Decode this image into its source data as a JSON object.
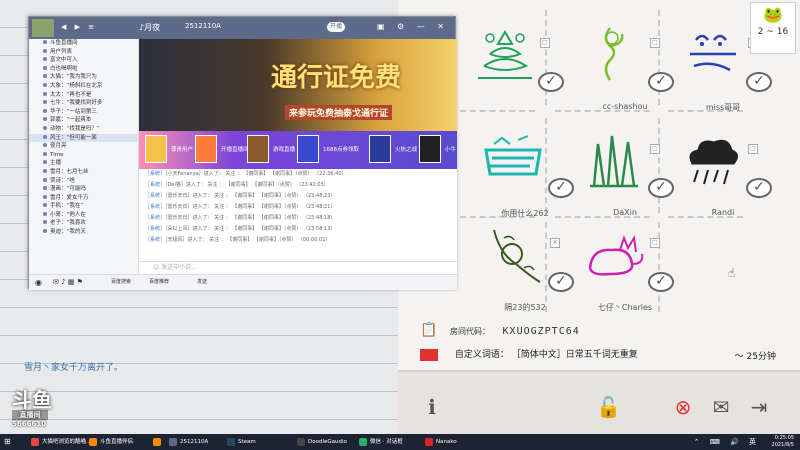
{
  "colors": {
    "accent": "#5d6a8a",
    "gold": "#ffe27a",
    "chat_link": "#3a78c8",
    "taskbar": "#1c2433"
  },
  "background": {
    "chat_message": "雪月丶家女千万离开了。",
    "logo": {
      "text": "斗鱼",
      "sub": "直播间",
      "room": "5666610"
    }
  },
  "game": {
    "round": "2 ~ 16",
    "round_icon": "frog-icon",
    "players": [
      {
        "name": "",
        "color": "#22a05a"
      },
      {
        "name": "cc-shashou",
        "color": "#7bbd2a"
      },
      {
        "name": "miss哥哥",
        "color": "#2840b0"
      },
      {
        "name": "你用什么262",
        "color": "#19b7b0"
      },
      {
        "name": "DaXin",
        "color": "#2a8a4a"
      },
      {
        "name": "Randi",
        "color": "#333333"
      },
      {
        "name": "隔23的532",
        "color": "#3a5a1a"
      },
      {
        "name": "七仔丶Charles",
        "color": "#d020b0"
      }
    ],
    "room_code_label": "房间代码：",
    "room_code": "KXUOGZPTC64",
    "custom_words_label": "自定义词语：",
    "custom_words": "［简体中文］日常五千词无重复",
    "duration": "～ 25分钟",
    "buttons": {
      "info": "info-icon",
      "lock": "lock-icon",
      "kick": "kick-icon",
      "invite": "invite-icon",
      "exit": "exit-icon"
    }
  },
  "app": {
    "title": {
      "channel": "♪月夜",
      "room": "2512110A",
      "badge": "开播"
    },
    "sidebar_rows": [
      "斗鱼直播间",
      "用户列表",
      "富文中可入",
      "白也喝啊啦",
      "大猫：“我为我只为",
      "大象：“杨斜杠在北京",
      "太太：“再也不是",
      "七牛：“我要找到好多",
      "华子：“一站到第三",
      "郭嘉：“一起爽本",
      "动物：“找我是吗？”",
      "风王：“但可能一笑",
      "夜月亮",
      "Time",
      "主播",
      "雪月：七月七丝",
      "贾诗：“啥",
      "漫画：“可能吗",
      "雪月：爱女千万",
      "手机：“我在”",
      "小哥：“他人在",
      "老子：“我喜欢",
      "奥迪：“我的天"
    ],
    "banner": {
      "headline": "通行证免费",
      "subline": "来参玩免费抽泰戈通行证"
    },
    "cards": [
      "尊贵用户",
      "开播直播间",
      "游戏直播",
      "1688点券领取",
      "火热之战",
      "小牛"
    ],
    "messages": [
      {
        "who": "［系统］",
        "text": "［小天Fenanya］进入了：      关注  ：  【谢同事】  【谢同事】（点赞） （22:36:40）"
      },
      {
        "who": "［系统］",
        "text": "［Dei猫］进入了：      关注  ：  【谢同事】  【谢同事】（点赞） （23:42:03）"
      },
      {
        "who": "［系统］",
        "text": "［雷乐天日］进入了：      关注  ：  【谢同事】  【谢同事】（点赞） （23:48:23）"
      },
      {
        "who": "［系统］",
        "text": "［雷乐天日］进入了：      关注  ：  【谢同事】  【谢同事】（点赞） （23:48:21）"
      },
      {
        "who": "［系统］",
        "text": "［雷乐天日］进入了：      关注  ：  【谢同事】  【谢同事】（点赞） （23:48:18）"
      },
      {
        "who": "［系统］",
        "text": "［朵以上风］进入了：      关注  ：  【谢同事】  【谢同事】（点赞） （23:58:13）"
      },
      {
        "who": "［系统］",
        "text": "［无极风］进入了：      关注  ：  【谢同事】  【谢同事】（点赞） （00:00:01）"
      }
    ],
    "input_placeholder": "发送中小说...",
    "footer": {
      "left": "百度搜索",
      "mid": "百度推荐",
      "right": "发送"
    }
  },
  "taskbar": {
    "items": [
      {
        "label": "大猫吧浏览的酷喵...",
        "color": "#e14c3c"
      },
      {
        "label": "斗鱼直播伴侣",
        "color": "#ff8a00"
      },
      {
        "label": "",
        "color": "#ff8a00"
      },
      {
        "label": "2512110A",
        "color": "#5d6a8a"
      },
      {
        "label": "Steam",
        "color": "#2a475e"
      },
      {
        "label": "DoodleGaudio",
        "color": "#444"
      },
      {
        "label": "微信 · 对话框",
        "color": "#2aae67"
      },
      {
        "label": "Nanako",
        "color": "#d22"
      }
    ],
    "time": "0:25:05",
    "date": "2021/8/5"
  }
}
